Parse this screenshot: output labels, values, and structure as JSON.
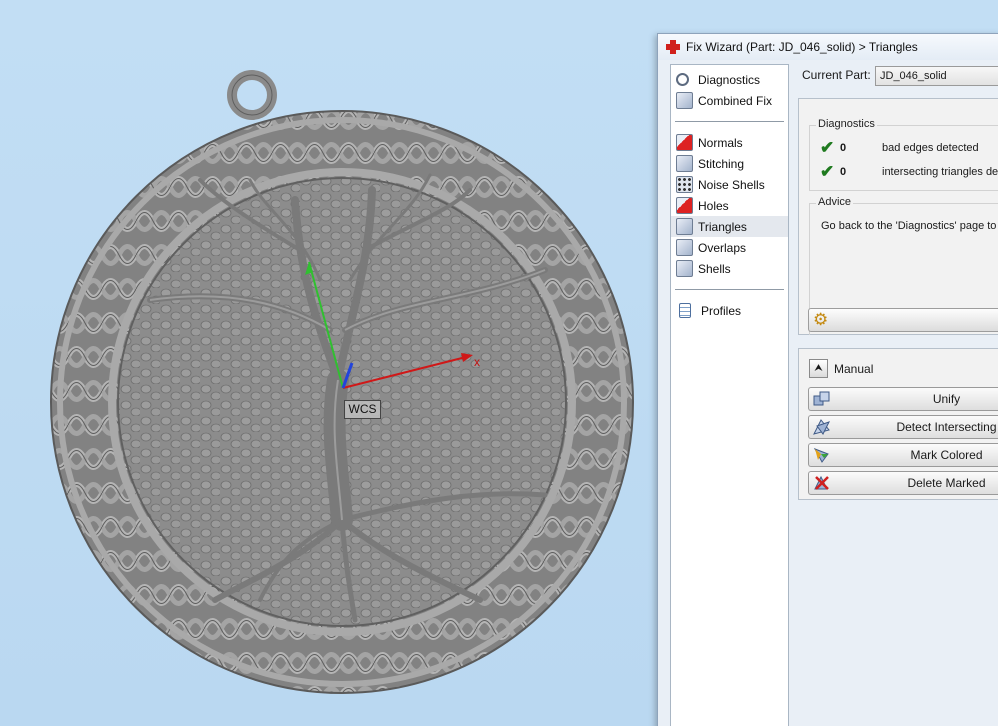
{
  "viewport": {
    "wcs_label": "WCS",
    "axis_x_label": "x",
    "colors": {
      "background": "#bddbf3",
      "model": "#8f8f8f",
      "x_axis": "#d01818",
      "y_axis": "#30c030",
      "z_axis": "#2244dd"
    }
  },
  "wizard": {
    "title": "Fix Wizard (Part: JD_046_solid) > Triangles",
    "nav": {
      "group1": [
        {
          "label": "Diagnostics",
          "icon": "magnifier-icon"
        },
        {
          "label": "Combined Fix",
          "icon": "cube-icon"
        }
      ],
      "group2": [
        {
          "label": "Normals",
          "icon": "normals-cube-icon"
        },
        {
          "label": "Stitching",
          "icon": "stitching-icon"
        },
        {
          "label": "Noise Shells",
          "icon": "noise-dice-icon"
        },
        {
          "label": "Holes",
          "icon": "holes-cube-icon"
        },
        {
          "label": "Triangles",
          "icon": "triangles-cube-icon",
          "selected": true
        },
        {
          "label": "Overlaps",
          "icon": "overlaps-cube-icon"
        },
        {
          "label": "Shells",
          "icon": "shells-cube-icon"
        }
      ],
      "group3": [
        {
          "label": "Profiles",
          "icon": "document-icon"
        }
      ]
    },
    "current_part": {
      "label": "Current Part:",
      "value": "JD_046_solid"
    },
    "diagnostics": {
      "title": "Diagnostics",
      "rows": [
        {
          "count": "0",
          "text": "bad edges detected"
        },
        {
          "count": "0",
          "text": "intersecting triangles detected"
        }
      ]
    },
    "advice": {
      "title": "Advice",
      "text": "Go back to the 'Diagnostics' page to c"
    },
    "manual": {
      "label": "Manual",
      "buttons": [
        {
          "label": "Unify",
          "icon": "unify-icon"
        },
        {
          "label": "Detect Intersecting",
          "icon": "detect-intersecting-icon"
        },
        {
          "label": "Mark Colored",
          "icon": "mark-colored-icon"
        },
        {
          "label": "Delete Marked",
          "icon": "delete-marked-icon"
        }
      ]
    }
  }
}
